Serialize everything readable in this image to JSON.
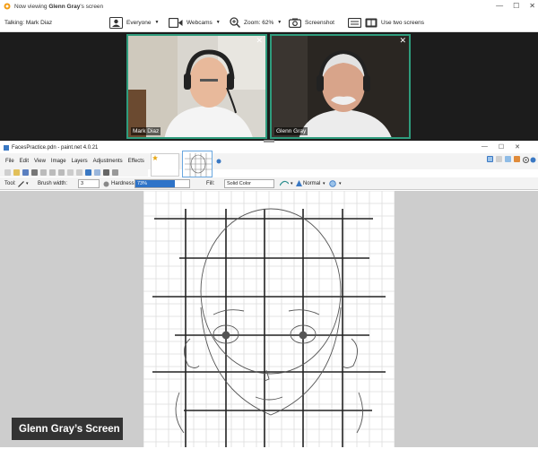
{
  "window": {
    "title_prefix": "Now viewing",
    "title_name": "Glenn Gray",
    "title_suffix": "'s screen"
  },
  "toolbar": {
    "talking": "Talking: Mark Diaz",
    "everyone_label": "Everyone",
    "webcams_label": "Webcams",
    "zoom_label": "Zoom: 62%",
    "screenshot_label": "Screenshot",
    "two_screens_label": "Use two screens"
  },
  "webcams": [
    {
      "name": "Mark Diaz"
    },
    {
      "name": "Glenn Gray"
    }
  ],
  "paintnet": {
    "title": "FacesPractice.pdn - paint.net 4.0.21",
    "menu": [
      "File",
      "Edit",
      "View",
      "Image",
      "Layers",
      "Adjustments",
      "Effects"
    ],
    "tool_label": "Tool:",
    "brush_width_label": "Brush width:",
    "brush_width_value": "3",
    "hardness_label": "Hardness:",
    "hardness_value": "73%",
    "fill_label": "Fill:",
    "fill_value": "Solid Color",
    "blend_value": "Normal"
  },
  "screen_label": "Glenn Gray’s Screen",
  "colors": {
    "accent_teal": "#2f9c7d",
    "hardness_fill": "#2e73c8",
    "dark_bg": "#1c1c1c",
    "workspace": "#cdcdcd"
  }
}
